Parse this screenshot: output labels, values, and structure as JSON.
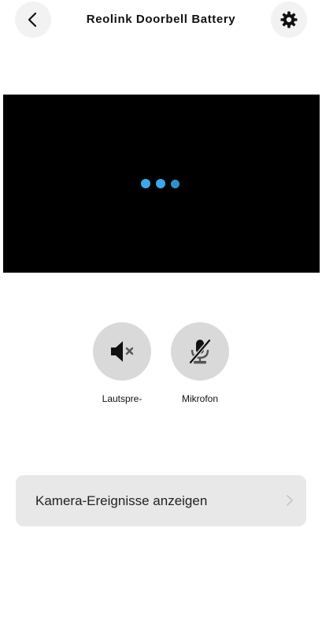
{
  "header": {
    "title": "Reolink Doorbell Battery"
  },
  "controls": {
    "speaker_label": "Lautspre-",
    "mic_label": "Mikrofon"
  },
  "events": {
    "label": "Kamera-Ereignisse anzeigen"
  },
  "icons": {
    "back": "chevron-left-icon",
    "settings": "gear-icon",
    "speaker": "speaker-muted-icon",
    "mic": "microphone-off-icon",
    "events_arrow": "chevron-right-icon"
  },
  "colors": {
    "loading_dots": "#3fa7e8",
    "video_bg": "#000000",
    "control_bg": "#d9d9d9",
    "card_bg": "#e8e8e8"
  }
}
